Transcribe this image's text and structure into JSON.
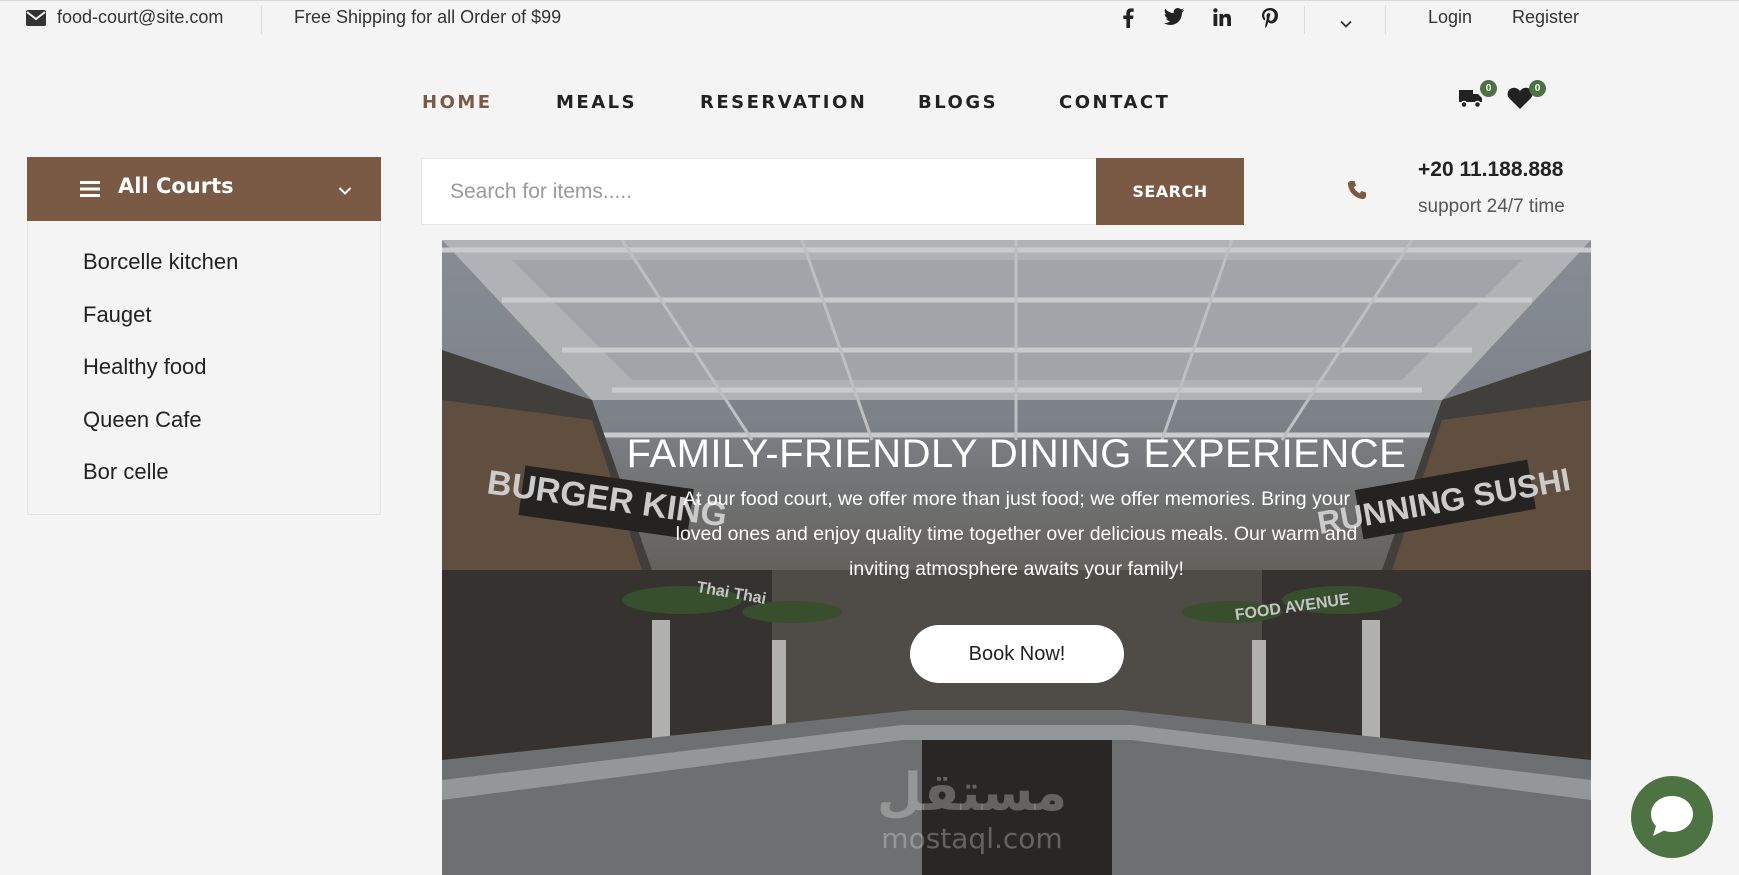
{
  "topbar": {
    "email": "food-court@site.com",
    "shipping": "Free Shipping for all Order of $99",
    "social_icons": [
      "facebook-icon",
      "twitter-icon",
      "linkedin-icon",
      "pinterest-icon"
    ],
    "login": "Login",
    "register": "Register"
  },
  "nav": {
    "items": [
      {
        "label": "HOME",
        "active": true
      },
      {
        "label": "MEALS",
        "active": false
      },
      {
        "label": "RESERVATION",
        "active": false
      },
      {
        "label": "BLOGS",
        "active": false
      },
      {
        "label": "CONTACT",
        "active": false
      }
    ],
    "cart_count": "0",
    "wishlist_count": "0"
  },
  "sidebar": {
    "title": "All Courts",
    "items": [
      {
        "label": "Borcelle kitchen"
      },
      {
        "label": "Fauget"
      },
      {
        "label": "Healthy food"
      },
      {
        "label": "Queen Cafe"
      },
      {
        "label": "Bor celle"
      }
    ]
  },
  "search": {
    "placeholder": "Search for items.....",
    "button": "SEARCH"
  },
  "support": {
    "phone": "+20 11.188.888",
    "subtitle": "support 24/7 time"
  },
  "hero": {
    "title": "FAMILY-FRIENDLY DINING EXPERIENCE",
    "text": "At our food court, we offer more than just food; we offer memories. Bring your loved ones and enjoy quality time together over delicious meals. Our warm and inviting atmosphere awaits your family!",
    "button": "Book Now!",
    "signs": [
      "BURGER KING",
      "RUNNING SUSHI",
      "FOOD AVENUE",
      "Thai Thai"
    ],
    "watermark_ar": "مستقل",
    "watermark_latin": "mostaql.com"
  },
  "colors": {
    "brand": "#7a5a45",
    "accent_green": "#4e7343",
    "background": "#f4f4f4"
  }
}
